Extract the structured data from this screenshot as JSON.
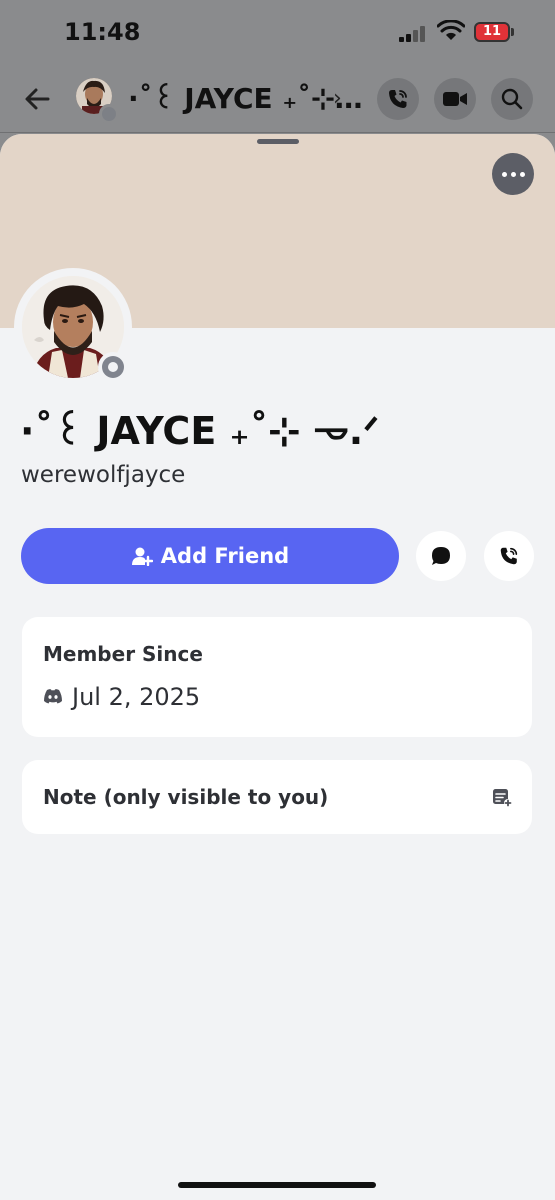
{
  "status_bar": {
    "time": "11:48",
    "battery": "11"
  },
  "nav": {
    "title": "·˚꒰ JAYCE ₊˚⊹…",
    "chevron": "›"
  },
  "profile": {
    "display_name": "·˚꒰ JAYCE ₊˚⊹ 𐃷.ᐟ",
    "username": "werewolfjayce"
  },
  "actions": {
    "add_friend_label": "Add Friend"
  },
  "member_since": {
    "title": "Member Since",
    "date": "Jul 2, 2025"
  },
  "note": {
    "title": "Note (only visible to you)"
  },
  "colors": {
    "accent": "#5865f2",
    "banner": "#e3d5c8",
    "sheet_bg": "#f2f3f5",
    "status_offline": "#80848e"
  },
  "icons": [
    "back-arrow-icon",
    "voice-call-icon",
    "video-call-icon",
    "search-icon",
    "more-icon",
    "add-friend-icon",
    "message-icon",
    "call-icon",
    "discord-logo-icon",
    "note-add-icon"
  ]
}
